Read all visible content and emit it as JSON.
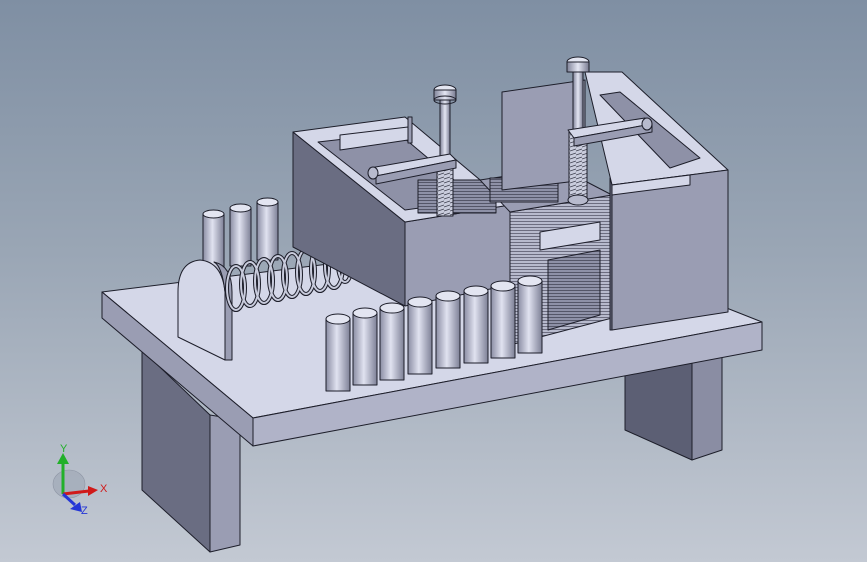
{
  "viewport": {
    "background_top": "#7f8fa3",
    "background_bottom": "#c3c9d3"
  },
  "model": {
    "face_light": "#d4d7e8",
    "face_mid": "#9a9db3",
    "face_dark": "#6a6d82",
    "edge": "#1d1e2a"
  },
  "triad": {
    "x_label": "X",
    "y_label": "Y",
    "z_label": "Z",
    "x_color": "#d01a1a",
    "y_color": "#22b02a",
    "z_color": "#2436d6"
  }
}
